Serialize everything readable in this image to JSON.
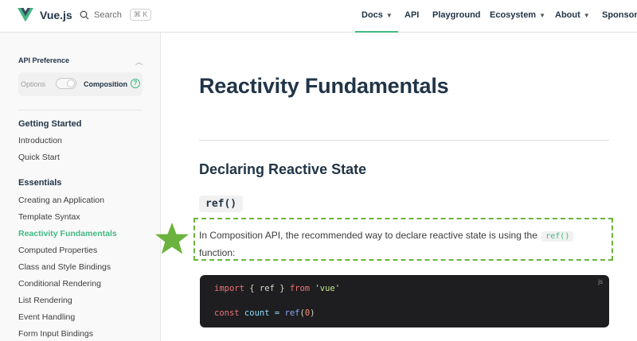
{
  "brand": {
    "name": "Vue.js"
  },
  "search": {
    "label": "Search",
    "shortcut": "⌘ K"
  },
  "nav": {
    "docs": "Docs",
    "api": "API",
    "playground": "Playground",
    "ecosystem": "Ecosystem",
    "about": "About",
    "sponsor": "Sponsor"
  },
  "sidebar": {
    "api_pref_title": "API Preference",
    "opt_options": "Options",
    "opt_composition": "Composition",
    "help": "?",
    "sections": [
      {
        "title": "Getting Started",
        "items": [
          "Introduction",
          "Quick Start"
        ]
      },
      {
        "title": "Essentials",
        "items": [
          "Creating an Application",
          "Template Syntax",
          "Reactivity Fundamentals",
          "Computed Properties",
          "Class and Style Bindings",
          "Conditional Rendering",
          "List Rendering",
          "Event Handling",
          "Form Input Bindings"
        ]
      }
    ],
    "active_item": "Reactivity Fundamentals"
  },
  "main": {
    "title": "Reactivity Fundamentals",
    "section_title": "Declaring Reactive State",
    "subsection_code": "ref()",
    "para_before": "In Composition API, the recommended way to declare reactive state is using the ",
    "para_code": "ref()",
    "para_after": " function:",
    "code_lang": "js",
    "code": {
      "line1": {
        "kw1": "import",
        "p1": " { ref } ",
        "kw2": "from",
        "str": " 'vue'"
      },
      "line2": {
        "kw": "const",
        "var": " count",
        "op": " = ",
        "fn": "ref",
        "open": "(",
        "num": "0",
        "close": ")"
      }
    }
  },
  "colors": {
    "accent": "#42b883",
    "highlight_border": "#6bb33e",
    "star": "#6bb33e",
    "code_bg": "#1e1e20"
  }
}
